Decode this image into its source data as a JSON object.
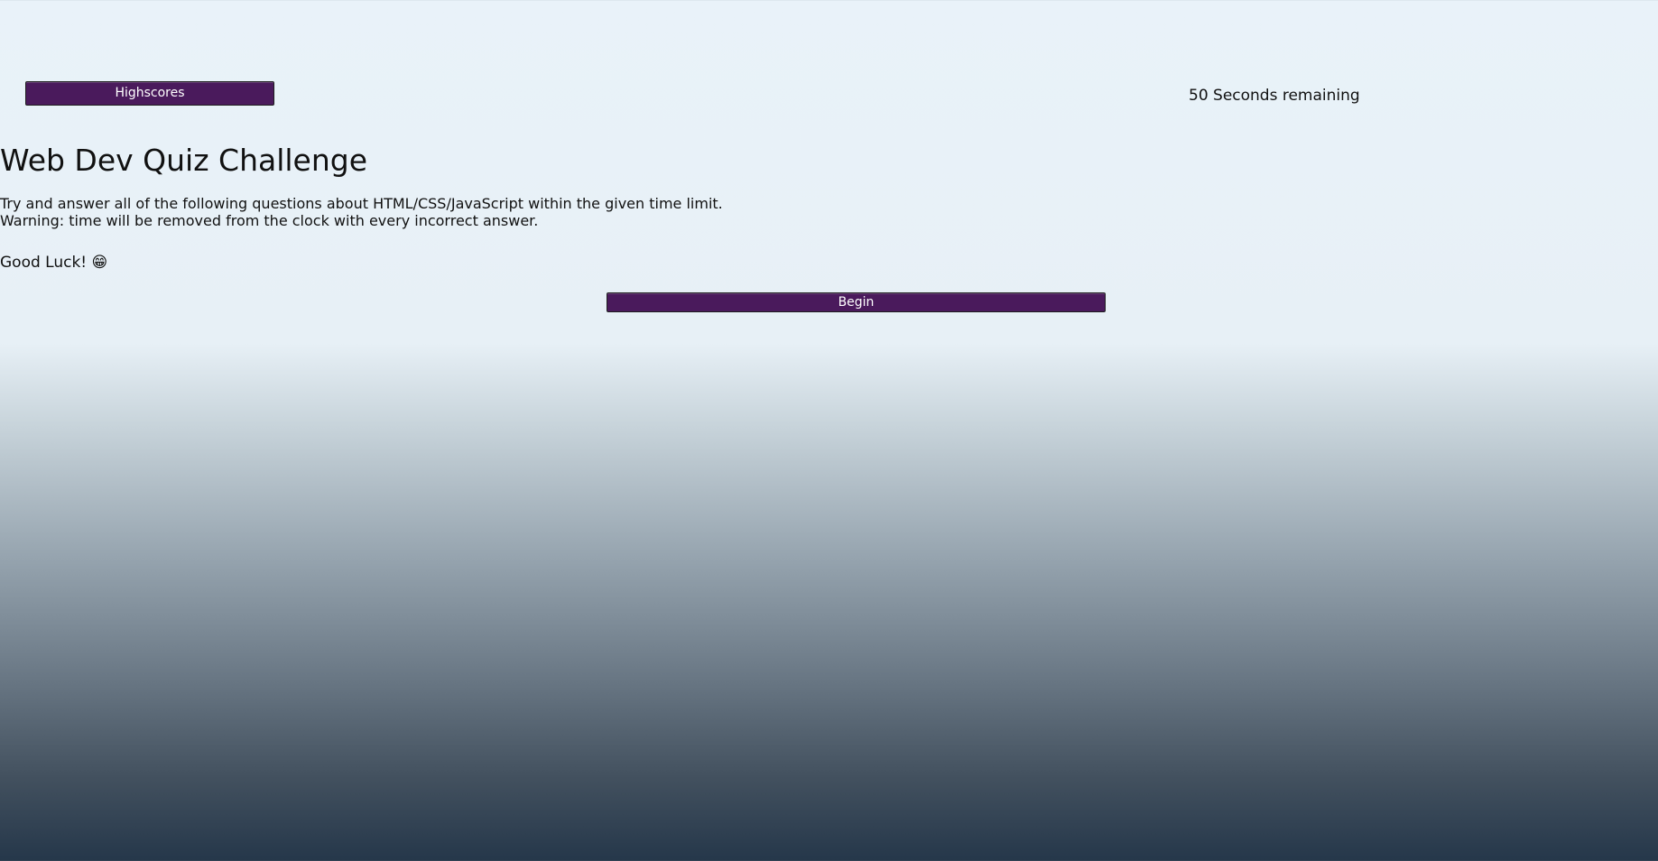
{
  "header": {
    "highscores_label": "Highscores",
    "timer_text": "50 Seconds remaining"
  },
  "main": {
    "title": "Web Dev Quiz Challenge",
    "instructions_line1": "Try and answer all of the following questions about HTML/CSS/JavaScript within the given time limit.",
    "instructions_line2": "Warning: time will be removed from the clock with every incorrect answer.",
    "good_luck": "Good Luck! 😁",
    "begin_label": "Begin"
  },
  "colors": {
    "button_bg": "#4a1a5c",
    "button_text": "#ffffff",
    "page_top": "#e9f2f9",
    "page_bottom": "#25374a"
  }
}
